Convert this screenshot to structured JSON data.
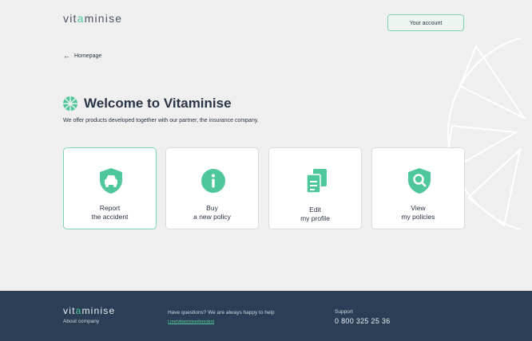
{
  "header": {
    "logo_prefix": "vit",
    "logo_accent": "a",
    "logo_suffix": "minise",
    "account_label": "Your account"
  },
  "nav": {
    "back_label": "Homepage"
  },
  "main": {
    "title": "Welcome to Vitaminise",
    "subtitle": "We offer products developed together with our partner, the insurance company."
  },
  "cards": [
    {
      "line1": "Report",
      "line2": "the accident",
      "icon": "car-shield-icon"
    },
    {
      "line1": "Buy",
      "line2": "a new policy",
      "icon": "info-icon"
    },
    {
      "line1": "Edit",
      "line2": "my profile",
      "icon": "documents-icon"
    },
    {
      "line1": "View",
      "line2": "my policies",
      "icon": "search-shield-icon"
    }
  ],
  "footer": {
    "logo_prefix": "vit",
    "logo_accent": "a",
    "logo_suffix": "minise",
    "about": "About company",
    "questions": "Have questions? We are always happy to help",
    "link": "t.me/vitaminisedemobot",
    "support_label": "Support",
    "phone": "0 800 325 25 36"
  },
  "colors": {
    "accent": "#4ec89a",
    "footer_bg": "#2c3e55",
    "text": "#2a3447"
  }
}
